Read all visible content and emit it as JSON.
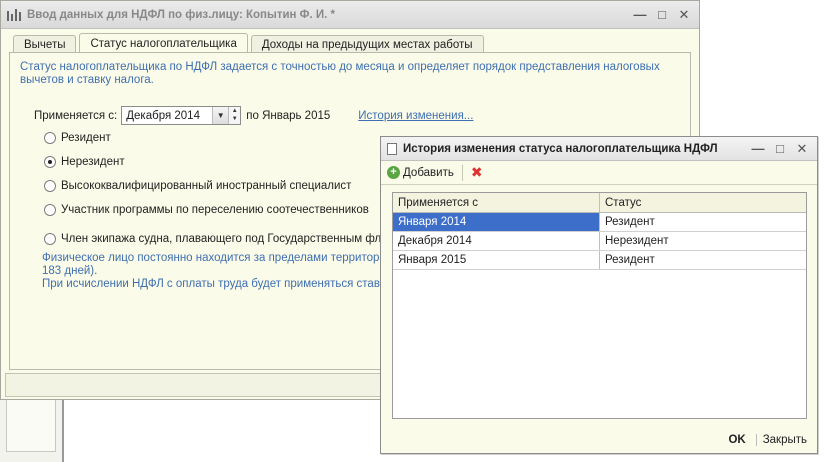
{
  "main_window": {
    "title": "Ввод данных для НДФЛ по физ.лицу: Копытин Ф. И. *",
    "tabs": [
      {
        "label": "Вычеты"
      },
      {
        "label": "Статус налогоплательщика"
      },
      {
        "label": "Доходы на предыдущих местах работы"
      }
    ],
    "description": "Статус налогоплательщика по НДФЛ задается с точностью до месяца и определяет порядок представления налоговых вычетов и ставку налога.",
    "applies_label": "Применяется с:",
    "applies_value": "Декабря 2014",
    "applies_to_label": "по Январь 2015",
    "history_link": "История изменения...",
    "radios": [
      {
        "label": "Резидент",
        "checked": false
      },
      {
        "label": "Нерезидент",
        "checked": true
      },
      {
        "label": "Высококвалифицированный иностранный специалист",
        "checked": false
      },
      {
        "label": "Участник программы по переселению соотечественников",
        "checked": false
      },
      {
        "label": "Член экипажа судна, плавающего под Государственным флаго",
        "checked": false
      }
    ],
    "note_line1": "Физическое лицо постоянно находится за пределами территори",
    "note_line2": "183 дней).",
    "note_line3": "При исчислении НДФЛ с оплаты труда будет применяться ставка"
  },
  "dialog": {
    "title": "История изменения статуса налогоплательщика НДФЛ",
    "add_label": "Добавить",
    "columns": [
      "Применяется с",
      "Статус"
    ],
    "rows": [
      {
        "date": "Января 2014",
        "status": "Резидент"
      },
      {
        "date": "Декабря 2014",
        "status": "Нерезидент"
      },
      {
        "date": "Января 2015",
        "status": "Резидент"
      }
    ],
    "ok_label": "OK",
    "close_label": "Закрыть"
  },
  "icons": {
    "window_controls": [
      "minimize-icon",
      "maximize-icon",
      "close-icon"
    ],
    "add_icon_color": "#5ba444",
    "selection_color": "#3d6ec9",
    "link_color": "#3e6fb0"
  }
}
